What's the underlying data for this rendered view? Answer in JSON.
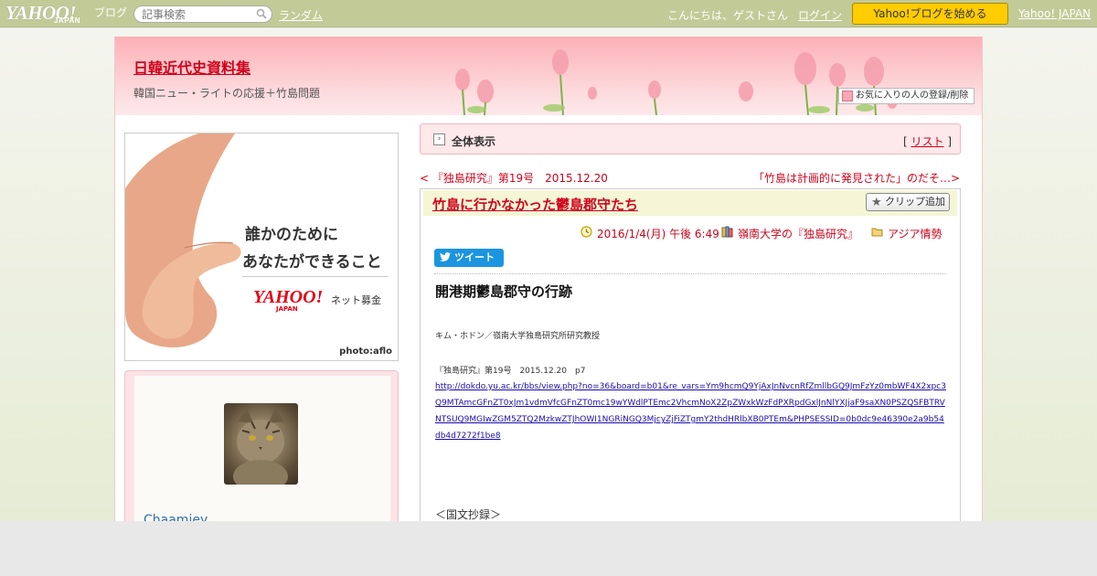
{
  "topbar": {
    "logo_text": "YAHOO!",
    "logo_sub": "JAPAN",
    "logo_blog": "ブログ",
    "search_placeholder": "記事検索",
    "random_link": "ランダム",
    "greeting": "こんにちは、ゲストさん",
    "login_link": "ログイン",
    "start_button": "Yahoo!ブログを始める",
    "yahoo_japan_link": "Yahoo! JAPAN"
  },
  "header": {
    "blog_title": "日韓近代史資料集",
    "blog_subtitle": "韓国ニュー・ライトの応援＋竹島問題",
    "favorite_button": "お気に入りの人の登録/削除"
  },
  "sidebar": {
    "banner": {
      "line1": "誰かのために",
      "line2": "あなたができること",
      "logo": "YAHOO!",
      "logo_sub": "JAPAN",
      "service": "ネット募金",
      "credit": "photo:aflo"
    },
    "profile": {
      "username": "Chaamiey"
    }
  },
  "main": {
    "all_view_label": "全体表示",
    "list_bracket_open": "[",
    "list_link": "リスト",
    "list_bracket_close": "]",
    "prev_link": "< 『独島研究』第19号　2015.12.20",
    "next_link": "「竹島は計画的に発見された」のだそ…>",
    "article": {
      "title": "竹島に行かなかった鬱島郡守たち",
      "clip_button": "クリップ追加",
      "date": "2016/1/4(月) 午後 6:49",
      "category1": "嶺南大学の『独島研究』",
      "category2": "アジア情勢",
      "tweet_button": "ツイート",
      "subtitle": "開港期鬱島郡守の行跡",
      "author": "キム・ホドン／嶺南大学独島研究所研究教授",
      "source": "『独島研究』第19号　2015.12.20　p7",
      "url": "http://dokdo.yu.ac.kr/bbs/view.php?no=36&board=b01&re_vars=Ym9hcmQ9YjAxJnNvcnRfZmllbGQ9JmFzYz0mbWF4X2xpc3Q9MTAmcGFnZT0xJm1vdmVfcGFnZT0mc19wYWdlPTEmc2VhcmNoX2ZpZWxkWzFdPXRpdGxlJnNlYXJjaF9saXN0PSZQSFBTRVNTSUQ9MGIwZGM5ZTQ2MzkwZTJhOWI1NGRiNGQ3MjcyZjFiZTgmY2thdHRlbXB0PTEm&PHPSESSID=0b0dc9e46390e2a9b54db4d7272f1be8",
      "kokubun": "＜国文抄録＞"
    }
  },
  "colors": {
    "link": "#d0021b",
    "topbar_bg": "#c2cb97",
    "start_button_bg": "#ffcc00",
    "header_pink": "#fcb0b6"
  }
}
